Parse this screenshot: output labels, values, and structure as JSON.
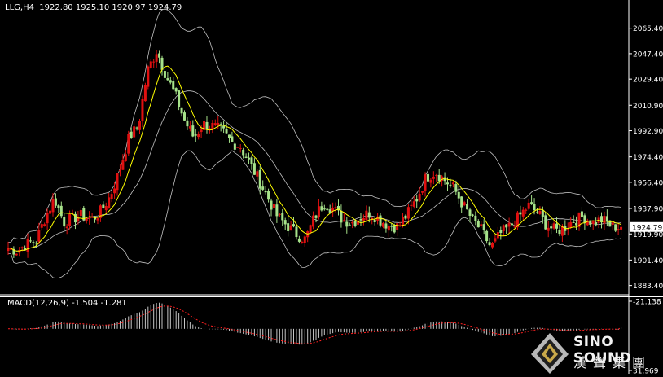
{
  "header": {
    "symbol": "LLG,H4",
    "open": "1922.80",
    "high": "1925.10",
    "low": "1920.97",
    "close": "1924.79",
    "text": "LLG,H4  1922.80 1925.10 1920.97 1924.79"
  },
  "macd_header": "MACD(12,26,9) -1.504 -1.281",
  "logo": {
    "title": "SINO SOUND",
    "subtitle": "漢聲集團"
  },
  "colors": {
    "background": "#000000",
    "bull_candle": "#e01010",
    "bear_candle": "#a6e28a",
    "bollinger": "#c0c0c0",
    "moving_average": "#ffff00",
    "macd_histogram": "#c8c8c8",
    "macd_signal": "#ff2020",
    "axis": "#ffffff"
  },
  "chart_data": [
    {
      "type": "candlestick",
      "title": "LLG,H4",
      "ylim": [
        1878,
        2075
      ],
      "y_ticks": [
        2065.4,
        2047.4,
        2029.4,
        2010.9,
        1992.9,
        1974.4,
        1956.4,
        1937.9,
        1919.9,
        1901.4,
        1883.4
      ],
      "y_tick_labels": [
        "2065.40",
        "2047.40",
        "2029.40",
        "2010.90",
        "1992.90",
        "1974.40",
        "1956.40",
        "1937.90",
        "1919.90",
        "1901.40",
        "1883.40"
      ],
      "current_price": 1924.79,
      "current_price_label": "1924.79",
      "price_path": [
        1910,
        1908,
        1913,
        1915,
        1932,
        1945,
        1928,
        1931,
        1933,
        1930,
        1936,
        1947,
        1965,
        1988,
        1996,
        2035,
        2050,
        2032,
        2018,
        2000,
        1988,
        1998,
        1996,
        1993,
        1985,
        1982,
        1970,
        1958,
        1945,
        1932,
        1926,
        1920,
        1916,
        1932,
        1942,
        1938,
        1930,
        1928,
        1932,
        1935,
        1930,
        1926,
        1925,
        1934,
        1945,
        1960,
        1964,
        1958,
        1952,
        1940,
        1930,
        1922,
        1910,
        1920,
        1925,
        1932,
        1940,
        1935,
        1926,
        1922,
        1925,
        1930,
        1932,
        1928,
        1930,
        1925,
        1924.79
      ],
      "indicators": [
        "Bollinger Bands (upper, middle, lower)",
        "Moving Average"
      ]
    },
    {
      "type": "bar",
      "title": "MACD(12,26,9) -1.504 -1.281",
      "ylim": [
        -21.138,
        31.969
      ],
      "y_ticks": [
        31.969,
        -21.138
      ],
      "y_tick_labels": [
        "31.969",
        "-21.138"
      ],
      "macd_value": -1.504,
      "signal_value": -1.281
    }
  ]
}
